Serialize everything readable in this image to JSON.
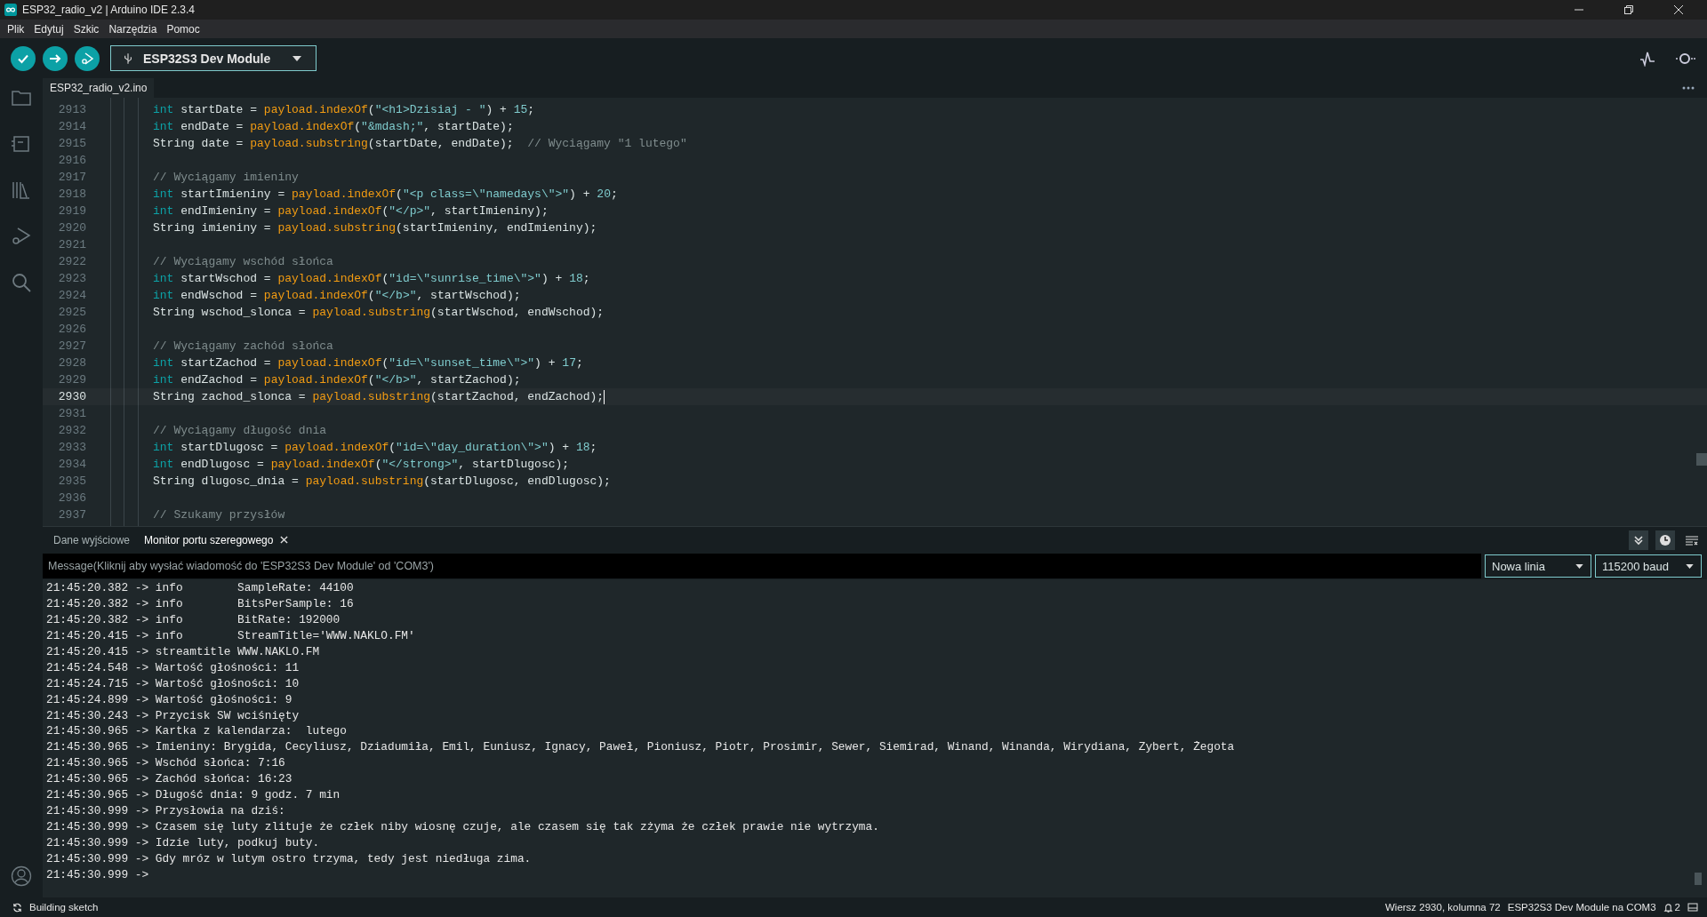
{
  "window": {
    "title": "ESP32_radio_v2 | Arduino IDE 2.3.4"
  },
  "menu": [
    "Plik",
    "Edytuj",
    "Szkic",
    "Narzędzia",
    "Pomoc"
  ],
  "toolbar": {
    "board": "ESP32S3 Dev Module"
  },
  "editor_tabs": [
    {
      "label": "ESP32_radio_v2.ino",
      "selected": true
    }
  ],
  "code_lines": [
    {
      "number": "2913",
      "current": false,
      "tokens": [
        {
          "kind": "type",
          "text": "int"
        },
        {
          "kind": "plain",
          "text": " startDate = "
        },
        {
          "kind": "call",
          "text": "payload.indexOf"
        },
        {
          "kind": "plain",
          "text": "("
        },
        {
          "kind": "string",
          "text": "\"<h1>Dzisiaj - \""
        },
        {
          "kind": "plain",
          "text": ") + "
        },
        {
          "kind": "number",
          "text": "15"
        },
        {
          "kind": "plain",
          "text": ";"
        }
      ]
    },
    {
      "number": "2914",
      "current": false,
      "tokens": [
        {
          "kind": "type",
          "text": "int"
        },
        {
          "kind": "plain",
          "text": " endDate = "
        },
        {
          "kind": "call",
          "text": "payload.indexOf"
        },
        {
          "kind": "plain",
          "text": "("
        },
        {
          "kind": "string",
          "text": "\"&mdash;\""
        },
        {
          "kind": "plain",
          "text": ", startDate);"
        }
      ]
    },
    {
      "number": "2915",
      "current": false,
      "tokens": [
        {
          "kind": "plain",
          "text": "String date = "
        },
        {
          "kind": "call",
          "text": "payload.substring"
        },
        {
          "kind": "plain",
          "text": "(startDate, endDate);  "
        },
        {
          "kind": "comment",
          "text": "// Wyciągamy \"1 lutego\""
        }
      ]
    },
    {
      "number": "2916",
      "current": false
    },
    {
      "number": "2917",
      "current": false,
      "tokens": [
        {
          "kind": "comment",
          "text": "// Wyciągamy imieniny"
        }
      ]
    },
    {
      "number": "2918",
      "current": false,
      "tokens": [
        {
          "kind": "type",
          "text": "int"
        },
        {
          "kind": "plain",
          "text": " startImieniny = "
        },
        {
          "kind": "call",
          "text": "payload.indexOf"
        },
        {
          "kind": "plain",
          "text": "("
        },
        {
          "kind": "string",
          "text": "\"<p class=\\\"namedays\\\">\""
        },
        {
          "kind": "plain",
          "text": ") + "
        },
        {
          "kind": "number",
          "text": "20"
        },
        {
          "kind": "plain",
          "text": ";"
        }
      ]
    },
    {
      "number": "2919",
      "current": false,
      "tokens": [
        {
          "kind": "type",
          "text": "int"
        },
        {
          "kind": "plain",
          "text": " endImieniny = "
        },
        {
          "kind": "call",
          "text": "payload.indexOf"
        },
        {
          "kind": "plain",
          "text": "("
        },
        {
          "kind": "string",
          "text": "\"</p>\""
        },
        {
          "kind": "plain",
          "text": ", startImieniny);"
        }
      ]
    },
    {
      "number": "2920",
      "current": false,
      "tokens": [
        {
          "kind": "plain",
          "text": "String imieniny = "
        },
        {
          "kind": "call",
          "text": "payload.substring"
        },
        {
          "kind": "plain",
          "text": "(startImieniny, endImieniny);"
        }
      ]
    },
    {
      "number": "2921",
      "current": false
    },
    {
      "number": "2922",
      "current": false,
      "tokens": [
        {
          "kind": "comment",
          "text": "// Wyciągamy wschód słońca"
        }
      ]
    },
    {
      "number": "2923",
      "current": false,
      "tokens": [
        {
          "kind": "type",
          "text": "int"
        },
        {
          "kind": "plain",
          "text": " startWschod = "
        },
        {
          "kind": "call",
          "text": "payload.indexOf"
        },
        {
          "kind": "plain",
          "text": "("
        },
        {
          "kind": "string",
          "text": "\"id=\\\"sunrise_time\\\">\""
        },
        {
          "kind": "plain",
          "text": ") + "
        },
        {
          "kind": "number",
          "text": "18"
        },
        {
          "kind": "plain",
          "text": ";"
        }
      ]
    },
    {
      "number": "2924",
      "current": false,
      "tokens": [
        {
          "kind": "type",
          "text": "int"
        },
        {
          "kind": "plain",
          "text": " endWschod = "
        },
        {
          "kind": "call",
          "text": "payload.indexOf"
        },
        {
          "kind": "plain",
          "text": "("
        },
        {
          "kind": "string",
          "text": "\"</b>\""
        },
        {
          "kind": "plain",
          "text": ", startWschod);"
        }
      ]
    },
    {
      "number": "2925",
      "current": false,
      "tokens": [
        {
          "kind": "plain",
          "text": "String wschod_slonca = "
        },
        {
          "kind": "call",
          "text": "payload.substring"
        },
        {
          "kind": "plain",
          "text": "(startWschod, endWschod);"
        }
      ]
    },
    {
      "number": "2926",
      "current": false
    },
    {
      "number": "2927",
      "current": false,
      "tokens": [
        {
          "kind": "comment",
          "text": "// Wyciągamy zachód słońca"
        }
      ]
    },
    {
      "number": "2928",
      "current": false,
      "tokens": [
        {
          "kind": "type",
          "text": "int"
        },
        {
          "kind": "plain",
          "text": " startZachod = "
        },
        {
          "kind": "call",
          "text": "payload.indexOf"
        },
        {
          "kind": "plain",
          "text": "("
        },
        {
          "kind": "string",
          "text": "\"id=\\\"sunset_time\\\">\""
        },
        {
          "kind": "plain",
          "text": ") + "
        },
        {
          "kind": "number",
          "text": "17"
        },
        {
          "kind": "plain",
          "text": ";"
        }
      ]
    },
    {
      "number": "2929",
      "current": false,
      "tokens": [
        {
          "kind": "type",
          "text": "int"
        },
        {
          "kind": "plain",
          "text": " endZachod = "
        },
        {
          "kind": "call",
          "text": "payload.indexOf"
        },
        {
          "kind": "plain",
          "text": "("
        },
        {
          "kind": "string",
          "text": "\"</b>\""
        },
        {
          "kind": "plain",
          "text": ", startZachod);"
        }
      ]
    },
    {
      "number": "2930",
      "current": true,
      "tokens": [
        {
          "kind": "plain",
          "text": "String zachod_slonca = "
        },
        {
          "kind": "call",
          "text": "payload.substring"
        },
        {
          "kind": "plain",
          "text": "(startZachod, endZachod);"
        }
      ]
    },
    {
      "number": "2931",
      "current": false
    },
    {
      "number": "2932",
      "current": false,
      "tokens": [
        {
          "kind": "comment",
          "text": "// Wyciągamy długość dnia"
        }
      ]
    },
    {
      "number": "2933",
      "current": false,
      "tokens": [
        {
          "kind": "type",
          "text": "int"
        },
        {
          "kind": "plain",
          "text": " startDlugosc = "
        },
        {
          "kind": "call",
          "text": "payload.indexOf"
        },
        {
          "kind": "plain",
          "text": "("
        },
        {
          "kind": "string",
          "text": "\"id=\\\"day_duration\\\">\""
        },
        {
          "kind": "plain",
          "text": ") + "
        },
        {
          "kind": "number",
          "text": "18"
        },
        {
          "kind": "plain",
          "text": ";"
        }
      ]
    },
    {
      "number": "2934",
      "current": false,
      "tokens": [
        {
          "kind": "type",
          "text": "int"
        },
        {
          "kind": "plain",
          "text": " endDlugosc = "
        },
        {
          "kind": "call",
          "text": "payload.indexOf"
        },
        {
          "kind": "plain",
          "text": "("
        },
        {
          "kind": "string",
          "text": "\"</strong>\""
        },
        {
          "kind": "plain",
          "text": ", startDlugosc);"
        }
      ]
    },
    {
      "number": "2935",
      "current": false,
      "tokens": [
        {
          "kind": "plain",
          "text": "String dlugosc_dnia = "
        },
        {
          "kind": "call",
          "text": "payload.substring"
        },
        {
          "kind": "plain",
          "text": "(startDlugosc, endDlugosc);"
        }
      ]
    },
    {
      "number": "2936",
      "current": false
    },
    {
      "number": "2937",
      "current": false,
      "tokens": [
        {
          "kind": "comment",
          "text": "// Szukamy przysłów"
        }
      ]
    }
  ],
  "panel_tabs": [
    {
      "label": "Dane wyjściowe",
      "selected": false,
      "closable": false
    },
    {
      "label": "Monitor portu szeregowego",
      "selected": true,
      "closable": true
    }
  ],
  "panel_tools": [
    {
      "kind": "autoscroll",
      "on": true
    },
    {
      "kind": "timestamp",
      "on": true
    },
    {
      "kind": "clear",
      "on": false
    }
  ],
  "message": {
    "placeholder": "Message(Kliknij aby wysłać wiadomość do 'ESP32S3 Dev Module' od 'COM3')"
  },
  "line_ending": "Nowa linia",
  "baud": "115200 baud",
  "serial_lines": [
    "21:45:20.382 -> info        SampleRate: 44100",
    "21:45:20.382 -> info        BitsPerSample: 16",
    "21:45:20.382 -> info        BitRate: 192000",
    "21:45:20.415 -> info        StreamTitle='WWW.NAKLO.FM'",
    "21:45:20.415 -> streamtitle WWW.NAKLO.FM",
    "21:45:24.548 -> Wartość głośności: 11",
    "21:45:24.715 -> Wartość głośności: 10",
    "21:45:24.899 -> Wartość głośności: 9",
    "21:45:30.243 -> Przycisk SW wciśnięty",
    "21:45:30.965 -> Kartka z kalendarza:  lutego",
    "21:45:30.965 -> Imieniny: Brygida, Cecyliusz, Dziadumiła, Emil, Euniusz, Ignacy, Paweł, Pioniusz, Piotr, Prosimir, Sewer, Siemirad, Winand, Winanda, Wirydiana, Zybert, Żegota",
    "21:45:30.965 -> Wschód słońca: 7:16",
    "21:45:30.965 -> Zachód słońca: 16:23",
    "21:45:30.965 -> Długość dnia: 9 godz. 7 min",
    "21:45:30.999 -> Przysłowia na dziś:",
    "21:45:30.999 -> Czasem się luty zlituje że człek niby wiosnę czuje, ale czasem się tak zżyma że człek prawie nie wytrzyma.",
    "21:45:30.999 -> Idzie luty, podkuj buty.",
    "21:45:30.999 -> Gdy mróz w lutym ostro trzyma, tedy jest niedługa zima.",
    "21:45:30.999 ->"
  ],
  "status_bar": {
    "task": "Building sketch",
    "position": "Wiersz 2930, kolumna 72",
    "board_port": "ESP32S3 Dev Module na COM3",
    "notifications": "2"
  }
}
